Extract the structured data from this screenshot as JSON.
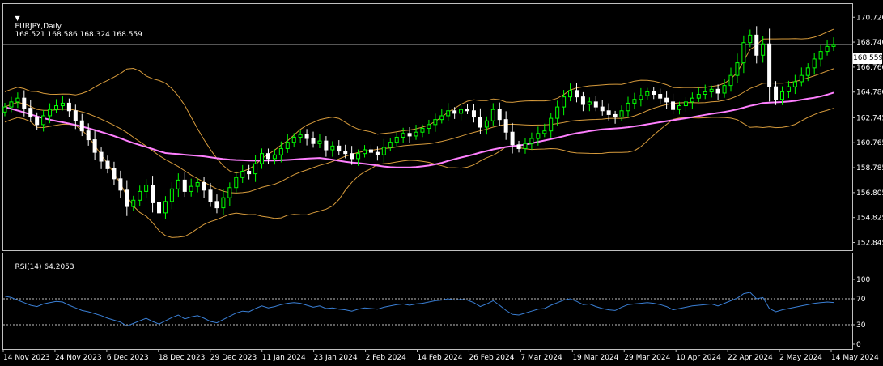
{
  "header": {
    "collapse_icon": "triangle-down-icon",
    "symbol_label": "EURJPY,Daily",
    "ohlc": "168.521 168.586 168.324 168.559"
  },
  "rsi_header": {
    "label": "RSI(14) 64.2053"
  },
  "price_axis": [
    "170.720",
    "168.740",
    "166.760",
    "164.780",
    "162.745",
    "160.765",
    "158.785",
    "156.805",
    "154.825",
    "152.845"
  ],
  "current_price": "168.559",
  "rsi_axis": [
    "100",
    "70",
    "30",
    "0"
  ],
  "time_axis": [
    "14 Nov 2023",
    "24 Nov 2023",
    "6 Dec 2023",
    "18 Dec 2023",
    "29 Dec 2023",
    "11 Jan 2024",
    "23 Jan 2024",
    "2 Feb 2024",
    "14 Feb 2024",
    "26 Feb 2024",
    "7 Mar 2024",
    "19 Mar 2024",
    "29 Mar 2024",
    "10 Apr 2024",
    "22 Apr 2024",
    "2 May 2024",
    "14 May 2024"
  ],
  "colors": {
    "background": "#000000",
    "frame": "#c0c0c0",
    "candle_up": "#00ff00",
    "candle_down": "#ffffff",
    "bollinger": "#d79b3c",
    "moving_average": "#ff7fff",
    "rsi_line": "#3a7fd5",
    "rsi_levels": "#c0c0c0",
    "price_line": "#8a8a8a"
  },
  "chart_data": [
    {
      "type": "candlestick",
      "title": "EURJPY,Daily",
      "ylim": [
        152.3,
        171.7
      ],
      "yticks": [
        170.72,
        168.74,
        166.76,
        164.78,
        162.745,
        160.765,
        158.785,
        156.805,
        154.825,
        152.845
      ],
      "current_price": 168.559,
      "indicators": [
        "Bollinger Bands",
        "Moving Average"
      ],
      "closes": [
        163.6,
        164.0,
        164.3,
        163.5,
        162.8,
        162.2,
        162.9,
        163.4,
        163.7,
        163.9,
        163.3,
        162.5,
        161.7,
        161.0,
        160.0,
        159.3,
        158.7,
        157.9,
        157.0,
        155.7,
        156.2,
        156.9,
        157.4,
        156.0,
        155.2,
        156.1,
        157.1,
        157.8,
        156.9,
        157.3,
        157.6,
        157.0,
        156.1,
        155.6,
        156.4,
        157.2,
        158.0,
        158.5,
        158.3,
        159.1,
        159.9,
        159.5,
        159.8,
        160.3,
        160.8,
        161.2,
        161.4,
        161.1,
        160.7,
        160.9,
        160.2,
        160.5,
        160.1,
        159.9,
        159.5,
        159.9,
        160.2,
        160.0,
        159.8,
        160.4,
        160.8,
        161.2,
        161.5,
        161.3,
        161.6,
        161.9,
        162.2,
        162.6,
        162.9,
        163.3,
        163.1,
        163.4,
        163.3,
        162.8,
        162.0,
        162.5,
        163.4,
        162.6,
        161.6,
        160.6,
        160.3,
        160.7,
        161.1,
        161.5,
        161.7,
        162.7,
        163.6,
        164.4,
        164.9,
        164.4,
        163.8,
        164.0,
        163.6,
        163.3,
        163.0,
        162.8,
        163.3,
        163.9,
        164.2,
        164.5,
        164.8,
        164.6,
        164.3,
        164.0,
        163.4,
        163.7,
        164.0,
        164.3,
        164.6,
        164.8,
        165.0,
        164.7,
        165.3,
        166.1,
        167.1,
        168.7,
        169.3,
        167.7,
        168.6,
        165.2,
        164.2,
        164.8,
        165.2,
        165.6,
        166.1,
        166.7,
        167.4,
        168.0,
        168.4,
        168.56
      ],
      "rsi": {
        "label": "RSI(14)",
        "current": 64.2053,
        "ylim": [
          0,
          100
        ],
        "levels": [
          70,
          30
        ],
        "values": [
          74,
          72,
          68,
          64,
          60,
          58,
          62,
          64,
          66,
          65,
          60,
          56,
          52,
          50,
          47,
          44,
          40,
          37,
          34,
          28,
          32,
          36,
          40,
          35,
          31,
          36,
          41,
          45,
          39,
          42,
          44,
          40,
          35,
          33,
          38,
          43,
          48,
          51,
          50,
          55,
          59,
          56,
          58,
          61,
          63,
          64,
          63,
          60,
          57,
          59,
          55,
          56,
          54,
          53,
          51,
          54,
          56,
          55,
          54,
          57,
          59,
          61,
          62,
          60,
          62,
          63,
          65,
          67,
          68,
          70,
          68,
          69,
          68,
          64,
          58,
          62,
          67,
          60,
          52,
          46,
          45,
          48,
          51,
          54,
          55,
          60,
          64,
          68,
          70,
          66,
          61,
          62,
          58,
          55,
          53,
          52,
          57,
          61,
          62,
          63,
          64,
          63,
          61,
          58,
          53,
          55,
          57,
          59,
          60,
          61,
          62,
          59,
          63,
          67,
          71,
          78,
          80,
          70,
          72,
          55,
          50,
          53,
          55,
          57,
          59,
          61,
          63,
          64,
          65,
          64.2
        ]
      }
    }
  ]
}
